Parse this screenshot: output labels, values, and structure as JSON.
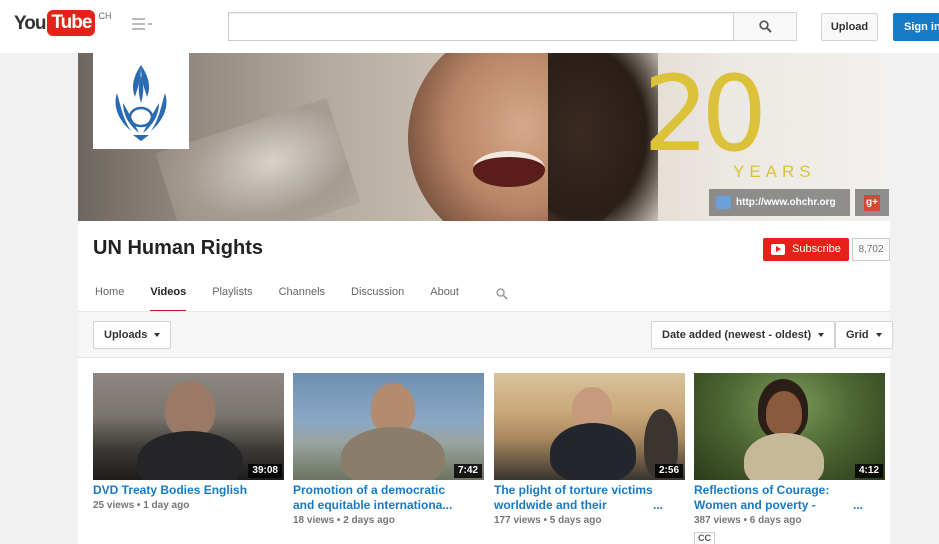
{
  "masthead": {
    "logo_you": "You",
    "logo_tube": "Tube",
    "region": "CH",
    "search_placeholder": "",
    "upload_label": "Upload",
    "signin_label": "Sign in"
  },
  "channel": {
    "title": "UN Human Rights",
    "banner_number": "20",
    "banner_years": "YEARS",
    "website_link": "http://www.ohchr.org",
    "gplus_label": "g+",
    "subscribe_label": "Subscribe",
    "subscriber_count": "8,702"
  },
  "tabs": [
    {
      "label": "Home",
      "active": false
    },
    {
      "label": "Videos",
      "active": true
    },
    {
      "label": "Playlists",
      "active": false
    },
    {
      "label": "Channels",
      "active": false
    },
    {
      "label": "Discussion",
      "active": false
    },
    {
      "label": "About",
      "active": false
    }
  ],
  "filters": {
    "uploads_label": "Uploads",
    "sort_label": "Date added (newest - oldest)",
    "view_label": "Grid"
  },
  "videos": [
    {
      "title_line1": "DVD Treaty Bodies English",
      "title_line2": "",
      "duration": "39:08",
      "meta": "25 views • 1 day ago",
      "cc": ""
    },
    {
      "title_line1": "Promotion of a democratic",
      "title_line2": "and equitable internationa...",
      "duration": "7:42",
      "meta": "18 views • 2 days ago",
      "cc": ""
    },
    {
      "title_line1": "The plight of torture victims",
      "title_line2": "worldwide and their",
      "ellipsis": "...",
      "duration": "2:56",
      "meta": "177 views • 5 days ago",
      "cc": ""
    },
    {
      "title_line1": "Reflections of Courage:",
      "title_line2": "Women and poverty -",
      "ellipsis": "...",
      "duration": "4:12",
      "meta": "387 views • 6 days ago",
      "cc": "CC"
    }
  ],
  "colors": {
    "brand_red": "#e62117",
    "link_blue": "#167ac6",
    "signin_blue": "#167ac6",
    "anniversary_gold": "#dcc23a"
  },
  "icons": {
    "guide": "guide-menu-icon",
    "search": "search-icon",
    "channel_search": "search-icon",
    "website": "website-favicon-icon",
    "gplus": "google-plus-icon",
    "subscribe": "youtube-play-icon"
  }
}
